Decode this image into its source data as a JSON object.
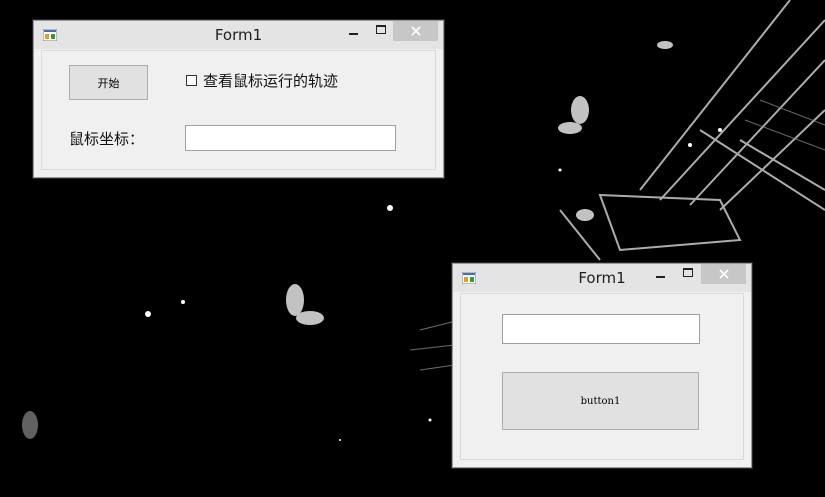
{
  "desktop": {
    "background_color": "#000000"
  },
  "window1": {
    "title": "Form1",
    "start_button_label": "开始",
    "checkbox_label": "查看鼠标运行的轨迹",
    "checkbox_checked": false,
    "coord_label": "鼠标坐标：",
    "coord_value": ""
  },
  "window2": {
    "title": "Form1",
    "textbox_value": "",
    "button_label": "button1"
  },
  "icons": {
    "app": "winform-app-icon",
    "minimize": "minimize-icon",
    "maximize": "maximize-icon",
    "close": "close-icon"
  },
  "colors": {
    "close_button": "#c7c7c7",
    "titlebar": "#e4e4e4",
    "window_body": "#f0f0f0"
  }
}
